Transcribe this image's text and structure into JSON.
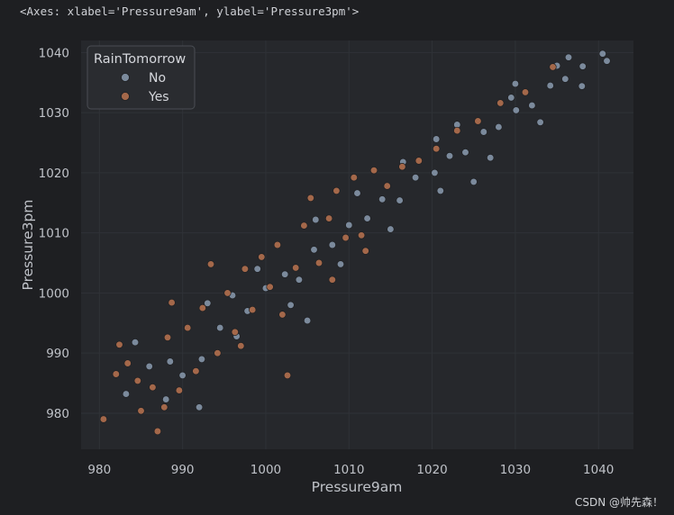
{
  "header": {
    "repr_text": "<Axes: xlabel='Pressure9am', ylabel='Pressure3pm'>"
  },
  "watermark": "CSDN @帅先森！",
  "colors": {
    "figure_bg": "#1e1f22",
    "axes_bg": "#26282c",
    "grid": "#2f3237",
    "no": "#7b8a9c",
    "yes": "#a4684a"
  },
  "chart_data": {
    "type": "scatter",
    "xlabel": "Pressure9am",
    "ylabel": "Pressure3pm",
    "xlim": [
      977.8,
      1044.2
    ],
    "ylim": [
      974.0,
      1042.0
    ],
    "xticks": [
      980,
      990,
      1000,
      1010,
      1020,
      1030,
      1040
    ],
    "yticks": [
      980,
      990,
      1000,
      1010,
      1020,
      1030,
      1040
    ],
    "grid": true,
    "legend": {
      "title": "RainTomorrow",
      "placement": "top-left",
      "entries": [
        "No",
        "Yes"
      ]
    },
    "series": [
      {
        "name": "No",
        "color": "#7b8a9c",
        "points": [
          [
            983.2,
            983.2
          ],
          [
            984.3,
            991.8
          ],
          [
            986.0,
            987.8
          ],
          [
            988.5,
            988.6
          ],
          [
            990.0,
            986.3
          ],
          [
            992.3,
            989.0
          ],
          [
            994.5,
            994.2
          ],
          [
            996.0,
            999.6
          ],
          [
            997.8,
            997.0
          ],
          [
            1000.0,
            1000.8
          ],
          [
            1002.3,
            1003.1
          ],
          [
            1004.0,
            1002.2
          ],
          [
            1005.8,
            1007.2
          ],
          [
            1008.0,
            1008.0
          ],
          [
            1010.0,
            1011.3
          ],
          [
            1012.2,
            1012.4
          ],
          [
            1014.0,
            1015.6
          ],
          [
            1016.1,
            1015.4
          ],
          [
            1018.0,
            1019.2
          ],
          [
            1020.3,
            1020.0
          ],
          [
            1022.1,
            1022.8
          ],
          [
            1024.0,
            1023.4
          ],
          [
            1026.2,
            1026.8
          ],
          [
            1028.0,
            1027.6
          ],
          [
            1030.1,
            1030.4
          ],
          [
            1032.0,
            1031.2
          ],
          [
            1034.2,
            1034.5
          ],
          [
            1036.0,
            1035.6
          ],
          [
            1038.1,
            1037.7
          ],
          [
            1040.5,
            1039.8
          ],
          [
            993.0,
            998.3
          ],
          [
            999.0,
            1004.0
          ],
          [
            1006.0,
            1012.2
          ],
          [
            1011.0,
            1016.6
          ],
          [
            1016.5,
            1021.8
          ],
          [
            1023.0,
            1028.0
          ],
          [
            1029.5,
            1032.5
          ],
          [
            1035.0,
            1037.8
          ],
          [
            996.5,
            992.8
          ],
          [
            1003.0,
            998.0
          ],
          [
            1009.0,
            1004.8
          ],
          [
            1015.0,
            1010.6
          ],
          [
            1021.0,
            1017.0
          ],
          [
            1027.0,
            1022.5
          ],
          [
            1033.0,
            1028.4
          ],
          [
            1038.0,
            1034.4
          ],
          [
            1041.0,
            1038.6
          ],
          [
            988.0,
            982.3
          ],
          [
            992.0,
            981.0
          ],
          [
            1020.5,
            1025.6
          ],
          [
            1030.0,
            1034.8
          ],
          [
            1036.4,
            1039.2
          ],
          [
            1025.0,
            1018.5
          ],
          [
            1005.0,
            995.4
          ]
        ]
      },
      {
        "name": "Yes",
        "color": "#a4684a",
        "points": [
          [
            980.5,
            979.0
          ],
          [
            982.0,
            986.5
          ],
          [
            982.4,
            991.4
          ],
          [
            983.4,
            988.3
          ],
          [
            984.6,
            985.4
          ],
          [
            985.0,
            980.4
          ],
          [
            986.4,
            984.3
          ],
          [
            987.0,
            977.0
          ],
          [
            987.8,
            981.0
          ],
          [
            988.2,
            992.6
          ],
          [
            988.7,
            998.4
          ],
          [
            989.6,
            983.8
          ],
          [
            990.6,
            994.2
          ],
          [
            991.6,
            987.0
          ],
          [
            992.4,
            997.5
          ],
          [
            993.4,
            1004.8
          ],
          [
            994.2,
            990.0
          ],
          [
            995.4,
            1000.0
          ],
          [
            996.3,
            993.5
          ],
          [
            997.5,
            1004.0
          ],
          [
            998.4,
            997.2
          ],
          [
            999.5,
            1006.0
          ],
          [
            1000.5,
            1001.0
          ],
          [
            1001.4,
            1008.0
          ],
          [
            1002.6,
            986.3
          ],
          [
            1003.6,
            1004.2
          ],
          [
            1004.6,
            1011.2
          ],
          [
            1005.4,
            1015.8
          ],
          [
            1006.4,
            1005.0
          ],
          [
            1007.6,
            1012.4
          ],
          [
            1008.5,
            1017.0
          ],
          [
            1009.6,
            1009.2
          ],
          [
            1010.6,
            1019.2
          ],
          [
            1011.5,
            1009.6
          ],
          [
            1013.0,
            1020.4
          ],
          [
            1014.6,
            1017.8
          ],
          [
            1016.4,
            1021.0
          ],
          [
            1018.4,
            1022.0
          ],
          [
            1020.5,
            1024.0
          ],
          [
            1023.0,
            1027.0
          ],
          [
            1025.5,
            1028.6
          ],
          [
            1028.2,
            1031.6
          ],
          [
            1031.2,
            1033.4
          ],
          [
            1034.5,
            1037.6
          ],
          [
            997.0,
            991.2
          ],
          [
            1002.0,
            996.4
          ],
          [
            1008.0,
            1002.2
          ],
          [
            1012.0,
            1007.0
          ]
        ]
      }
    ]
  }
}
